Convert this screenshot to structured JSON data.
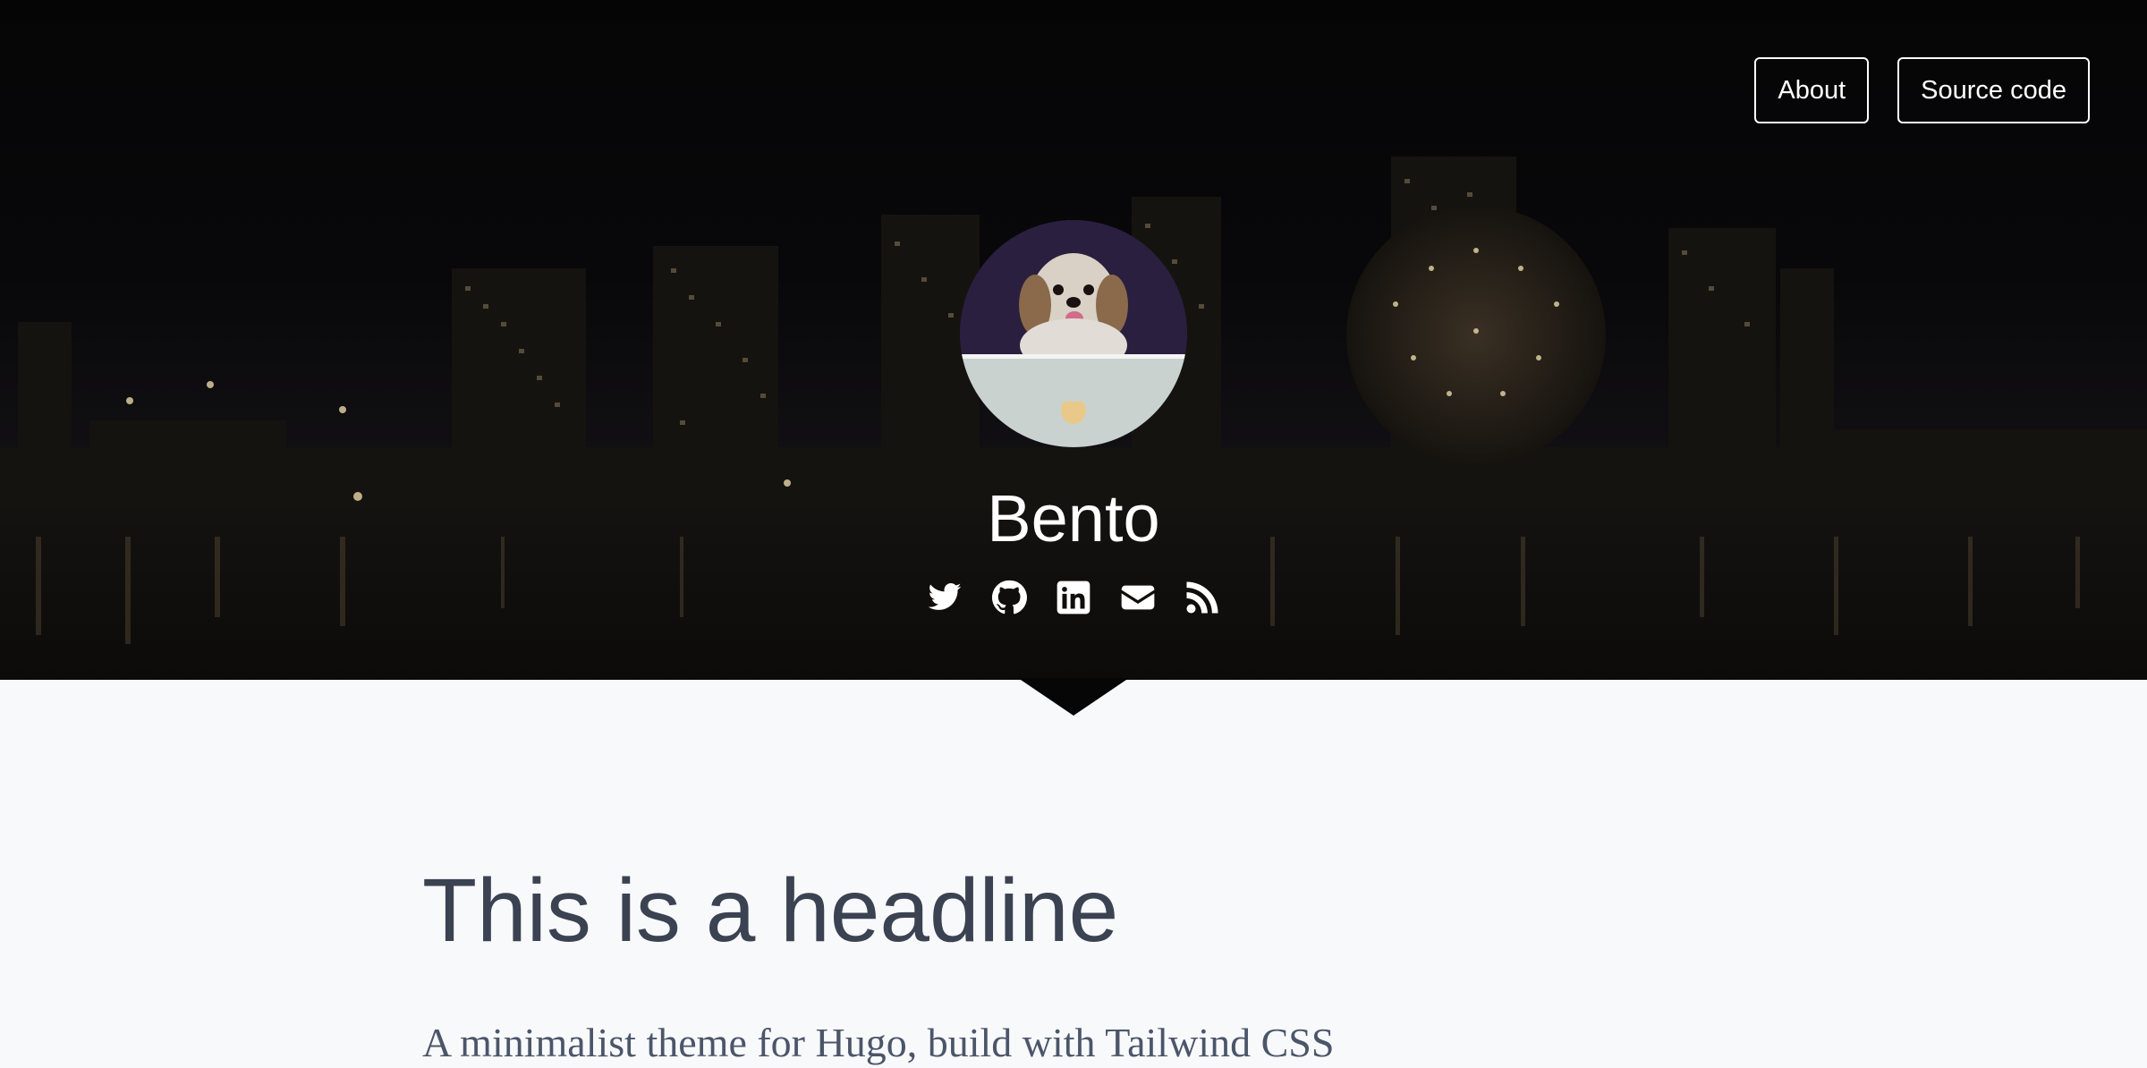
{
  "nav": {
    "about_label": "About",
    "source_label": "Source code"
  },
  "site": {
    "title": "Bento"
  },
  "socials": [
    "twitter-icon",
    "github-icon",
    "linkedin-icon",
    "email-icon",
    "rss-icon"
  ],
  "content": {
    "headline": "This is a headline",
    "intro": "A minimalist theme for Hugo, build with Tailwind CSS"
  },
  "colors": {
    "hero_bg": "#050506",
    "page_bg": "#f8f9fb",
    "headline": "#3b4252",
    "nav_border": "#ffffff"
  }
}
